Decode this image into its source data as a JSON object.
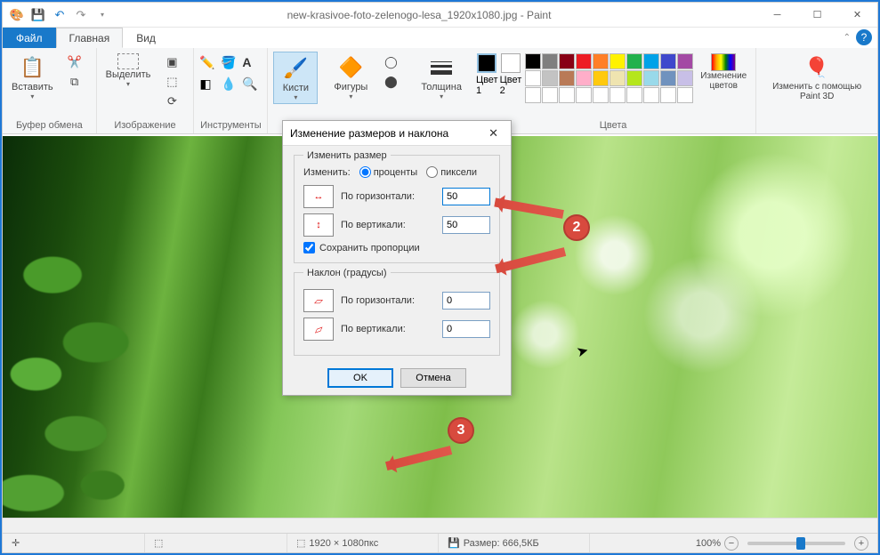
{
  "titlebar": {
    "filename": "new-krasivoe-foto-zelenogo-lesa_1920x1080.jpg - Paint"
  },
  "menubar": {
    "file": "Файл",
    "home": "Главная",
    "view": "Вид"
  },
  "ribbon": {
    "clipboard": {
      "paste": "Вставить",
      "label": "Буфер обмена"
    },
    "image": {
      "select": "Выделить",
      "label": "Изображение"
    },
    "tools": {
      "label": "Инструменты"
    },
    "brushes": {
      "btn": "Кисти"
    },
    "shapes": {
      "btn": "Фигуры"
    },
    "size": {
      "btn": "Толщина"
    },
    "color1": {
      "btn": "Цвет 1"
    },
    "color2": {
      "btn": "Цвет 2"
    },
    "colors": {
      "label": "Цвета",
      "edit": "Изменение цветов"
    },
    "paint3d": {
      "btn": "Изменить с помощью Paint 3D"
    }
  },
  "dialog": {
    "title": "Изменение размеров и наклона",
    "resize_group": "Изменить размер",
    "resize_by": "Изменить:",
    "percent": "проценты",
    "pixels": "пиксели",
    "horizontal": "По горизонтали:",
    "vertical": "По вертикали:",
    "h_val": "50",
    "v_val": "50",
    "keep_aspect": "Сохранить пропорции",
    "skew_group": "Наклон (градусы)",
    "skew_h": "По горизонтали:",
    "skew_v": "По вертикали:",
    "skew_h_val": "0",
    "skew_v_val": "0",
    "ok": "OK",
    "cancel": "Отмена"
  },
  "callouts": {
    "two": "2",
    "three": "3"
  },
  "statusbar": {
    "dimensions": "1920 × 1080пкс",
    "size": "Размер: 666,5КБ",
    "zoom": "100%"
  },
  "palette_row1": [
    "#000",
    "#7f7f7f",
    "#880015",
    "#ed1c24",
    "#ff7f27",
    "#fff200",
    "#22b14c",
    "#00a2e8",
    "#3f48cc",
    "#a349a4"
  ],
  "palette_row2": [
    "#fff",
    "#c3c3c3",
    "#b97a57",
    "#ffaec9",
    "#ffc90e",
    "#efe4b0",
    "#b5e61d",
    "#99d9ea",
    "#7092be",
    "#c8bfe7"
  ],
  "palette_row3": [
    "#fff",
    "#fff",
    "#fff",
    "#fff",
    "#fff",
    "#fff",
    "#fff",
    "#fff",
    "#fff",
    "#fff"
  ]
}
